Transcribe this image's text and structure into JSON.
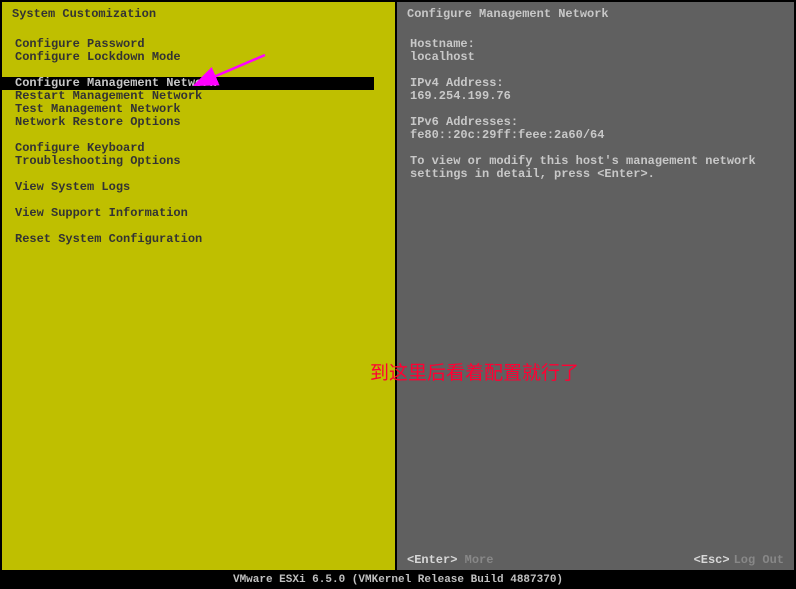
{
  "left_header": "System Customization",
  "right_header": "Configure Management Network",
  "menu": {
    "group1": [
      "Configure Password",
      "Configure Lockdown Mode"
    ],
    "group2": [
      "Configure Management Network",
      "Restart Management Network",
      "Test Management Network",
      "Network Restore Options"
    ],
    "group3": [
      "Configure Keyboard",
      "Troubleshooting Options"
    ],
    "group4": [
      "View System Logs"
    ],
    "group5": [
      "View Support Information"
    ],
    "group6": [
      "Reset System Configuration"
    ],
    "selected": "Configure Management Network"
  },
  "info": {
    "hostname_label": "Hostname:",
    "hostname_value": "localhost",
    "ipv4_label": "IPv4 Address:",
    "ipv4_value": "169.254.199.76",
    "ipv6_label": "IPv6 Addresses:",
    "ipv6_value": "fe80::20c:29ff:feee:2a60/64",
    "help_text": "To view or modify this host's management network settings in detail, press <Enter>."
  },
  "footer": {
    "enter_key": "<Enter>",
    "enter_action": "More",
    "esc_key": "<Esc>",
    "esc_action": "Log Out"
  },
  "version": "VMware ESXi 6.5.0 (VMKernel Release Build 4887370)",
  "annotation": "到这里后看着配置就行了"
}
